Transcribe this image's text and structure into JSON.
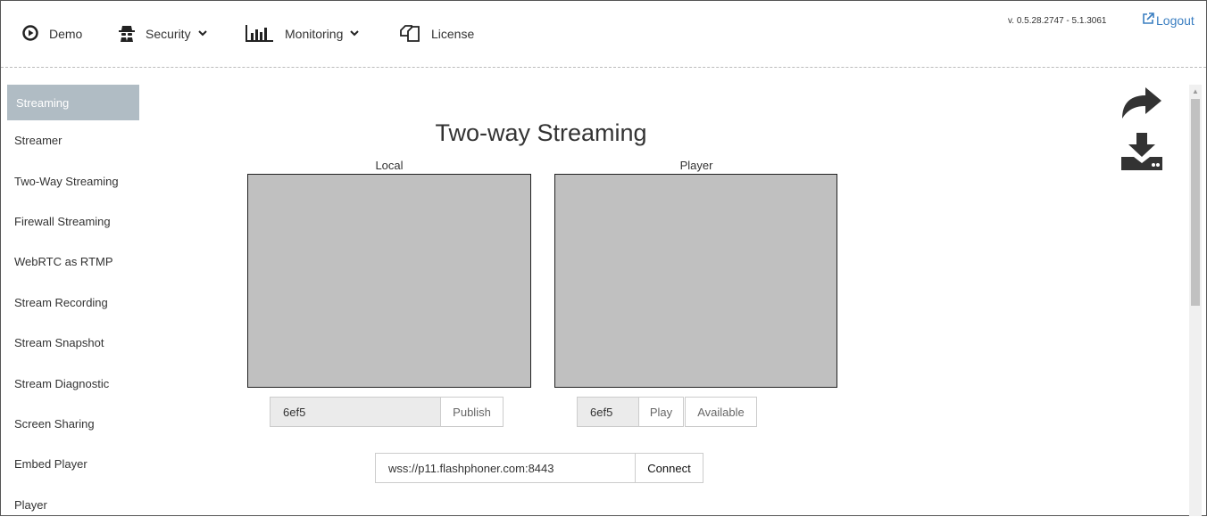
{
  "nav": {
    "demo_label": "Demo",
    "security_label": "Security",
    "monitoring_label": "Monitoring",
    "license_label": "License",
    "version": "v. 0.5.28.2747 - 5.1.3061",
    "logout_label": "Logout"
  },
  "sidebar": {
    "header": "Streaming",
    "items": [
      {
        "label": "Streamer"
      },
      {
        "label": "Two-Way Streaming"
      },
      {
        "label": "Firewall Streaming"
      },
      {
        "label": "WebRTC as RTMP"
      },
      {
        "label": "Stream Recording"
      },
      {
        "label": "Stream Snapshot"
      },
      {
        "label": "Stream Diagnostic"
      },
      {
        "label": "Screen Sharing"
      },
      {
        "label": "Embed Player"
      },
      {
        "label": "Player"
      }
    ]
  },
  "main": {
    "title": "Two-way Streaming",
    "local_label": "Local",
    "player_label": "Player",
    "publish_stream": "6ef5",
    "publish_button": "Publish",
    "play_stream": "6ef5",
    "play_button": "Play",
    "available_button": "Available",
    "server_url": "wss://p11.flashphoner.com:8443",
    "connect_button": "Connect"
  },
  "colors": {
    "sidebar_active_bg": "#b0bcc4",
    "video_bg": "#c0c0c0",
    "link": "#3a7ec1"
  },
  "icons": [
    "play-circle-icon",
    "spy-icon",
    "bar-chart-icon",
    "documents-icon",
    "external-link-icon",
    "share-arrow-icon",
    "download-icon"
  ]
}
